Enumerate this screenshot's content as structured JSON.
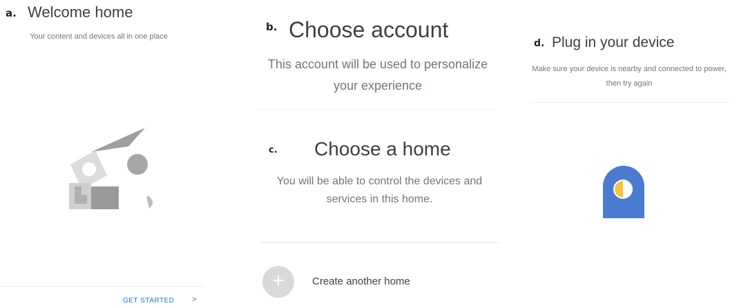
{
  "panel_a": {
    "tag": "a.",
    "title": "Welcome home",
    "subtitle": "Your content and devices all in one place",
    "illustration_icon": "home-shapes-illustration",
    "get_started_label": "GET STARTED",
    "chevron": ">"
  },
  "panel_b": {
    "tag": "b.",
    "title": "Choose account",
    "subtitle": "This account will be used to personalize your experience"
  },
  "panel_c": {
    "tag": "c.",
    "title": "Choose a home",
    "subtitle": "You will be able to control the devices and services in this home.",
    "create_home_icon": "plus-icon",
    "create_home_label": "Create another home"
  },
  "panel_d": {
    "tag": "d.",
    "title": "Plug in your device",
    "subtitle": "Make sure your device is nearby and connected to power, then try again",
    "device_icon": "smart-plug-icon"
  },
  "colors": {
    "accent": "#1a73e8",
    "device_blue": "#4a7bd0",
    "device_yellow": "#f6c33c"
  }
}
